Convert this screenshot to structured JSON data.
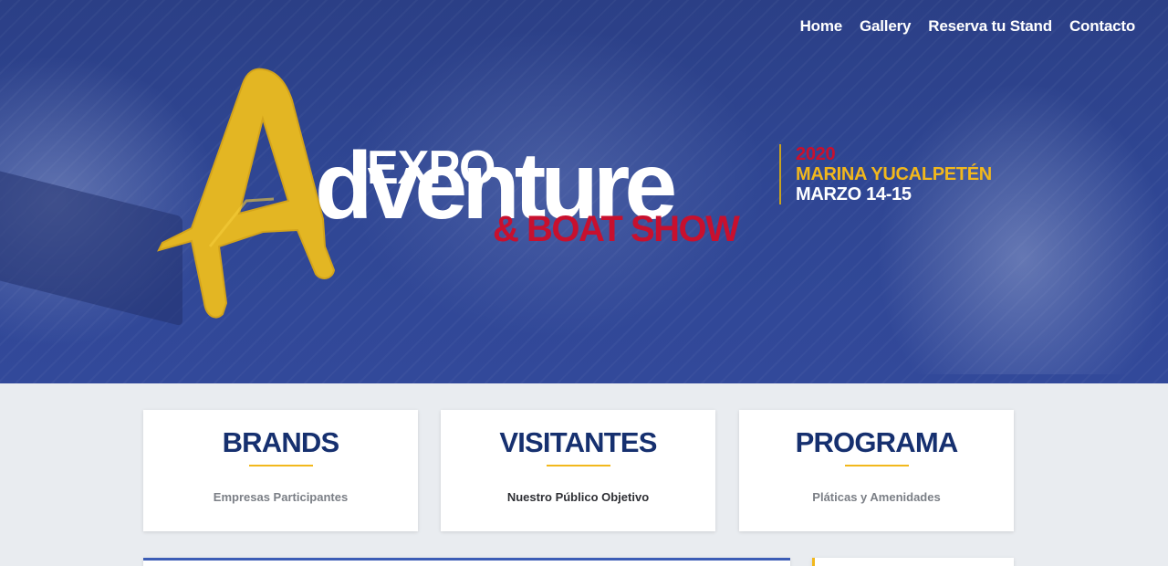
{
  "nav": {
    "items": [
      "Home",
      "Gallery",
      "Reserva tu Stand",
      "Contacto"
    ]
  },
  "hero": {
    "logo": {
      "expo": "EXPO",
      "adventure": "dventure",
      "boatshow": "& BOAT SHOW"
    },
    "event": {
      "year": "2020",
      "place": "MARINA YUCALPETÉN",
      "dates": "MARZO 14-15"
    }
  },
  "cards": [
    {
      "title": "BRANDS",
      "subtitle": "Empresas Participantes"
    },
    {
      "title": "VISITANTES",
      "subtitle": "Nuestro Público Objetivo"
    },
    {
      "title": "PROGRAMA",
      "subtitle": "Pláticas y Amenidades"
    }
  ],
  "colors": {
    "hero_blue": "#2f4693",
    "navy_title": "#16306f",
    "gold": "#f2b81c",
    "red": "#c8102e"
  }
}
